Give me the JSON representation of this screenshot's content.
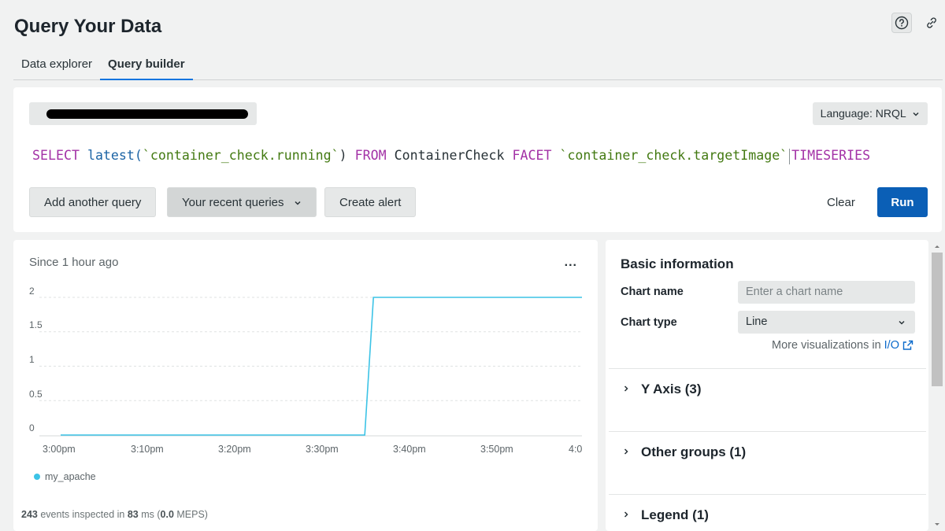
{
  "header": {
    "title": "Query Your Data"
  },
  "tabs": [
    {
      "label": "Data explorer",
      "active": false
    },
    {
      "label": "Query builder",
      "active": true
    }
  ],
  "query": {
    "language_label": "Language: NRQL",
    "tokens": {
      "select": "SELECT",
      "fn": "latest(",
      "attr1": "`container_check.running`",
      "close": ")",
      "from": "FROM",
      "event": "ContainerCheck",
      "facet": "FACET",
      "attr2": "`container_check.targetImage`",
      "timeseries": "TIMESERIES"
    },
    "buttons": {
      "add": "Add another query",
      "recent": "Your recent queries",
      "alert": "Create alert",
      "clear": "Clear",
      "run": "Run"
    }
  },
  "chart": {
    "since_label": "Since 1 hour ago",
    "menu_label": "...",
    "y_ticks": [
      "2",
      "1.5",
      "1",
      "0.5",
      "0"
    ],
    "x_ticks": [
      "3:00pm",
      "3:10pm",
      "3:20pm",
      "3:30pm",
      "3:40pm",
      "3:50pm",
      "4:0"
    ],
    "legend": "my_apache",
    "events": {
      "count": "243",
      "text1": " events inspected in ",
      "ms": "83",
      "text2": " ms (",
      "meps": "0.0",
      "text3": " MEPS)"
    }
  },
  "chart_data": {
    "type": "line",
    "x": [
      "3:00pm",
      "3:10pm",
      "3:20pm",
      "3:30pm",
      "3:35pm",
      "3:36pm",
      "3:40pm",
      "3:50pm",
      "4:00pm"
    ],
    "series": [
      {
        "name": "my_apache",
        "values": [
          0,
          0,
          0,
          0,
          0,
          2,
          2,
          2,
          2
        ],
        "color": "#3cc3e6"
      }
    ],
    "ylim": [
      0,
      2
    ],
    "grid": true,
    "legend_placement": "bottom-left"
  },
  "config": {
    "section_title": "Basic information",
    "chart_name_label": "Chart name",
    "chart_name_placeholder": "Enter a chart name",
    "chart_type_label": "Chart type",
    "chart_type_value": "Line",
    "more_viz_text": "More visualizations in",
    "more_viz_link": "I/O",
    "accordions": [
      {
        "label": "Y Axis (3)"
      },
      {
        "label": "Other groups (1)"
      },
      {
        "label": "Legend (1)"
      }
    ]
  },
  "colors": {
    "accent": "#0b5fb6",
    "series": "#3cc3e6",
    "keyword": "#a331a6",
    "string": "#437a12"
  }
}
